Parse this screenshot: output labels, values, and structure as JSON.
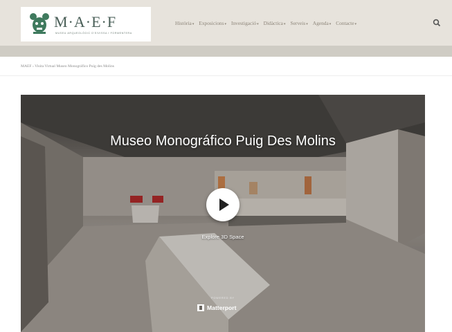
{
  "brand": {
    "name": "M·A·E·F",
    "tagline": "MUSEU ARQUEOLÒGIC D'EIVISSA I FORMENTERA"
  },
  "nav": {
    "items": [
      "Història",
      "Exposicions",
      "Investigació",
      "Didàctica",
      "Serveis",
      "Agenda",
      "Contacte"
    ],
    "search_icon": "search-icon"
  },
  "breadcrumb": "MAEF › Visita Virtual Museo Monográfico Puig des Molins",
  "tour": {
    "title": "Museo Monográfico Puig Des Molins",
    "cta": "Explore 3D Space",
    "powered_by": "POWERED BY",
    "provider": "Matterport"
  },
  "colors": {
    "header_bg": "#e7e3dc",
    "subbar_bg": "#cfccc4",
    "logo_green": "#4a5f58",
    "nav_text": "#8c8478"
  }
}
